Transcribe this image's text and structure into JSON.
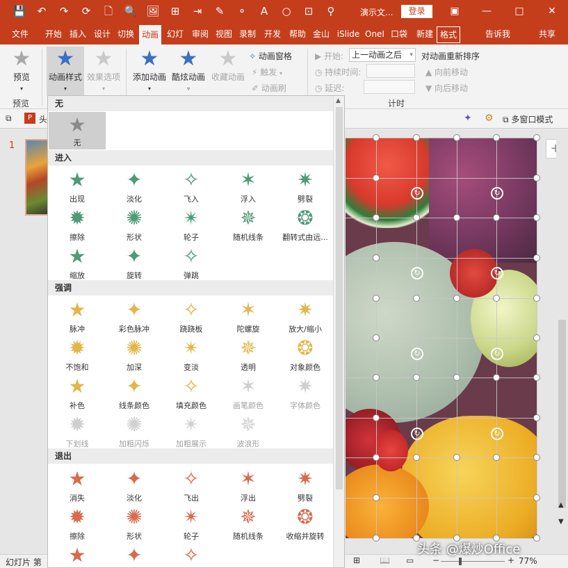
{
  "window": {
    "title": "演示文...",
    "login": "登录",
    "minimize": "—",
    "restore": "□",
    "close": "✕"
  },
  "quick_access": [
    "💾",
    "↶",
    "↷",
    "⟳",
    "🗋",
    "🔍",
    "🖼",
    "⊞",
    "⇥",
    "✎",
    "⚬",
    "A",
    "○",
    "⊡",
    "⚲"
  ],
  "tabs": [
    {
      "label": "文件"
    },
    {
      "label": "开始"
    },
    {
      "label": "插入"
    },
    {
      "label": "设计"
    },
    {
      "label": "切换"
    },
    {
      "label": "动画",
      "active": true
    },
    {
      "label": "幻灯"
    },
    {
      "label": "审阅"
    },
    {
      "label": "视图"
    },
    {
      "label": "录制"
    },
    {
      "label": "开发"
    },
    {
      "label": "帮助"
    },
    {
      "label": "金山"
    },
    {
      "label": "iSlide"
    },
    {
      "label": "OneI"
    },
    {
      "label": "口袋"
    },
    {
      "label": "新建"
    },
    {
      "label": "格式"
    },
    {
      "label": "告诉我"
    },
    {
      "label": "共享"
    }
  ],
  "ribbon": {
    "preview": {
      "label": "预览",
      "group": "预览"
    },
    "anim_style": "动画样式",
    "effect_options": "效果选项",
    "add_anim": "添加动画",
    "cool_anim": "酷炫动画",
    "fav_anim": "收藏动画",
    "anim_pane": "动画窗格",
    "trigger": "触发",
    "anim_brush": "动画刷",
    "start_label": "开始:",
    "start_value": "上一动画之后",
    "duration_label": "持续时间:",
    "delay_label": "延迟:",
    "timing_group": "计时",
    "reorder": "对动画重新排序",
    "move_earlier": "向前移动",
    "move_later": "向后移动"
  },
  "editor_toolbar": {
    "multi_window": "多窗口模式"
  },
  "slide_panel": {
    "number": "1",
    "tab_label": "头"
  },
  "status": {
    "slide_label": "幻灯片 第",
    "zoom": "77%"
  },
  "watermark": "头条 @爆炒Office",
  "dropdown": {
    "none_header": "无",
    "none_label": "无",
    "enter_header": "进入",
    "enter": [
      "出现",
      "淡化",
      "飞入",
      "浮入",
      "劈裂",
      "擦除",
      "形状",
      "轮子",
      "随机线条",
      "翻转式由远...",
      "缩放",
      "旋转",
      "弹跳"
    ],
    "emph_header": "强调",
    "emph": [
      "脉冲",
      "彩色脉冲",
      "跷跷板",
      "陀螺旋",
      "放大/缩小",
      "不饱和",
      "加深",
      "变淡",
      "透明",
      "对象颜色",
      "补色",
      "线条颜色",
      "填充颜色",
      "画笔颜色",
      "字体颜色",
      "下划线",
      "加粗闪烁",
      "加粗展示",
      "波浪形"
    ],
    "emph_disabled": [
      13,
      14,
      15,
      16,
      17,
      18
    ],
    "exit_header": "退出",
    "exit": [
      "消失",
      "淡化",
      "飞出",
      "浮出",
      "劈裂",
      "擦除",
      "形状",
      "轮子",
      "随机线条",
      "收缩并旋转",
      "缩放",
      "旋转",
      "弹跳"
    ]
  }
}
